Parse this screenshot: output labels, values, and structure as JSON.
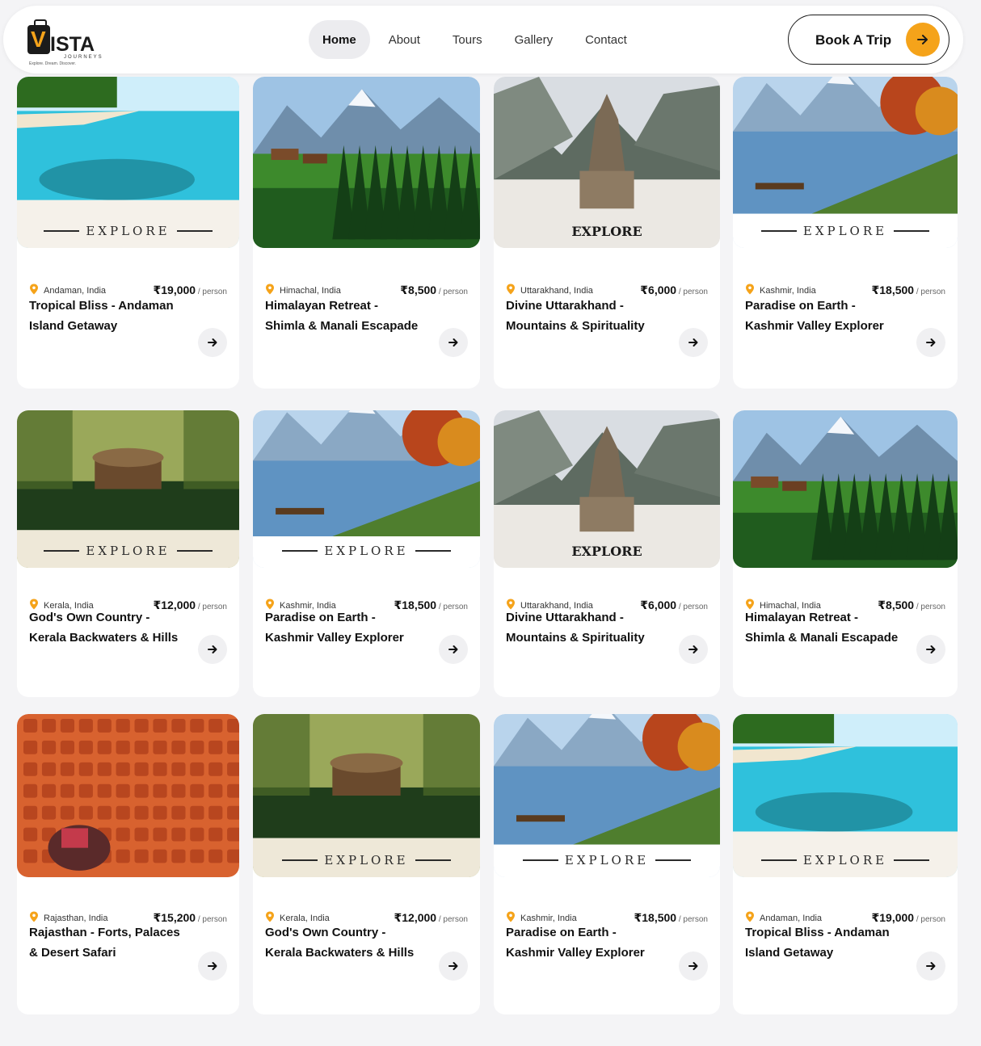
{
  "brand": {
    "name": "ISTA",
    "sub": "JOURNEYS",
    "tagline": "Explore. Dream. Discover."
  },
  "nav": {
    "items": [
      "Home",
      "About",
      "Tours",
      "Gallery",
      "Contact"
    ],
    "active": "Home"
  },
  "cta": {
    "label": "Book A Trip"
  },
  "colors": {
    "accent": "#f5a31a",
    "pin": "#f5a31a"
  },
  "tours": [
    {
      "location": "Andaman, India",
      "price": "₹19,000",
      "per": " / person",
      "title": "Tropical Bliss - Andaman Island Getaway",
      "explore": "EXPLORE",
      "scene": "beach"
    },
    {
      "location": "Himachal, India",
      "price": "₹8,500",
      "per": " / person",
      "title": "Himalayan Retreat - Shimla & Manali Escapade",
      "explore": "",
      "scene": "himalaya"
    },
    {
      "location": "Uttarakhand, India",
      "price": "₹6,000",
      "per": " / person",
      "title": "Divine Uttarakhand - Mountains & Spirituality",
      "explore": "EXPLORE",
      "scene": "temple"
    },
    {
      "location": "Kashmir, India",
      "price": "₹18,500",
      "per": " / person",
      "title": "Paradise on Earth - Kashmir Valley Explorer",
      "explore": "EXPLORE",
      "scene": "kashmir"
    },
    {
      "location": "Kerala, India",
      "price": "₹12,000",
      "per": " / person",
      "title": "God's Own Country - Kerala Backwaters & Hills",
      "explore": "EXPLORE",
      "scene": "kerala"
    },
    {
      "location": "Kashmir, India",
      "price": "₹18,500",
      "per": " / person",
      "title": "Paradise on Earth - Kashmir Valley Explorer",
      "explore": "EXPLORE",
      "scene": "kashmir"
    },
    {
      "location": "Uttarakhand, India",
      "price": "₹6,000",
      "per": " / person",
      "title": "Divine Uttarakhand - Mountains & Spirituality",
      "explore": "EXPLORE",
      "scene": "temple"
    },
    {
      "location": "Himachal, India",
      "price": "₹8,500",
      "per": " / person",
      "title": "Himalayan Retreat - Shimla & Manali Escapade",
      "explore": "",
      "scene": "himalaya"
    },
    {
      "location": "Rajasthan, India",
      "price": "₹15,200",
      "per": " / person",
      "title": "Rajasthan - Forts, Palaces & Desert Safari",
      "explore": "",
      "scene": "rajasthan"
    },
    {
      "location": "Kerala, India",
      "price": "₹12,000",
      "per": " / person",
      "title": "God's Own Country - Kerala Backwaters & Hills",
      "explore": "EXPLORE",
      "scene": "kerala"
    },
    {
      "location": "Kashmir, India",
      "price": "₹18,500",
      "per": " / person",
      "title": "Paradise on Earth - Kashmir Valley Explorer",
      "explore": "EXPLORE",
      "scene": "kashmir"
    },
    {
      "location": "Andaman, India",
      "price": "₹19,000",
      "per": " / person",
      "title": "Tropical Bliss - Andaman Island Getaway",
      "explore": "EXPLORE",
      "scene": "beach"
    }
  ]
}
